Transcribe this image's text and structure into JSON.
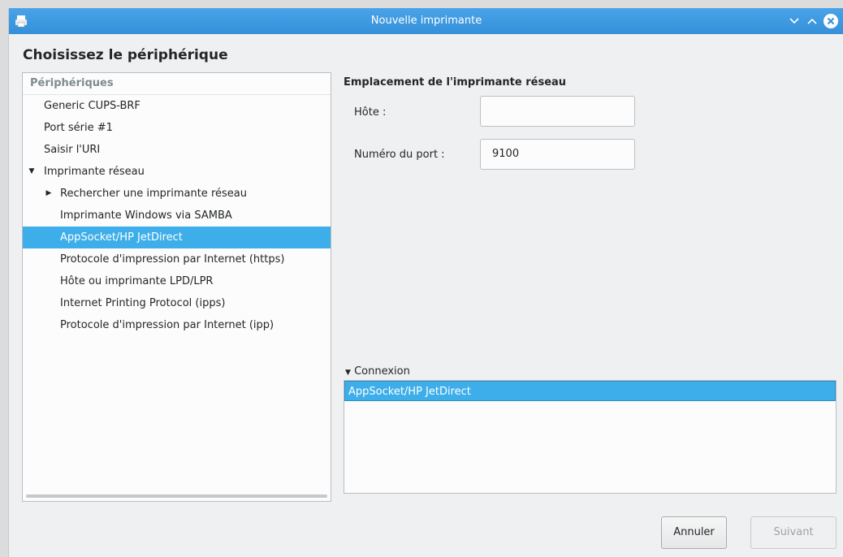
{
  "window": {
    "title": "Nouvelle imprimante",
    "icons": {
      "app": "printer-icon",
      "minimize": "chevron-down-icon",
      "maximize": "chevron-up-icon",
      "close": "close-icon"
    },
    "accent": "#3daee9"
  },
  "heading": "Choisissez le périphérique",
  "devices": {
    "header": "Périphériques",
    "items": [
      {
        "label": "Generic CUPS-BRF",
        "level": 0
      },
      {
        "label": "Port série #1",
        "level": 0
      },
      {
        "label": "Saisir l'URI",
        "level": 0
      },
      {
        "label": "Imprimante réseau",
        "level": 0,
        "expander": "expanded"
      },
      {
        "label": "Rechercher une imprimante réseau",
        "level": 1,
        "expander": "collapsed"
      },
      {
        "label": "Imprimante Windows via SAMBA",
        "level": 1
      },
      {
        "label": "AppSocket/HP JetDirect",
        "level": 1,
        "selected": true
      },
      {
        "label": "Protocole d'impression par Internet (https)",
        "level": 1
      },
      {
        "label": "Hôte ou imprimante LPD/LPR",
        "level": 1
      },
      {
        "label": "Internet Printing Protocol (ipps)",
        "level": 1
      },
      {
        "label": "Protocole d'impression par Internet (ipp)",
        "level": 1
      }
    ]
  },
  "network_location": {
    "title": "Emplacement de l'imprimante réseau",
    "host_label": "Hôte :",
    "host_value": "",
    "port_label": "Numéro du port :",
    "port_value": "9100"
  },
  "connection": {
    "toggle_label": "Connexion",
    "items": [
      "AppSocket/HP JetDirect"
    ]
  },
  "buttons": {
    "cancel": "Annuler",
    "next": "Suivant"
  }
}
